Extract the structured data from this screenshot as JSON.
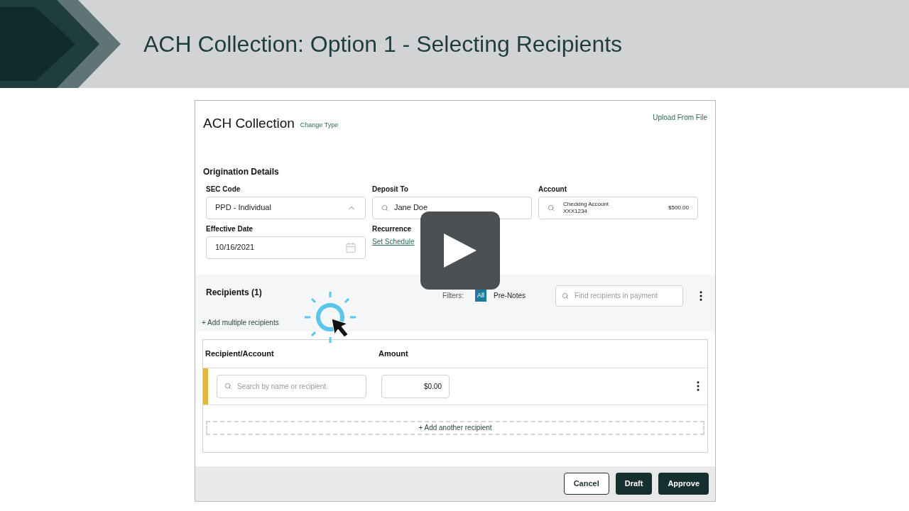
{
  "slide": {
    "title": "ACH Collection: Option 1 - Selecting Recipients"
  },
  "header": {
    "title": "ACH Collection",
    "change_link": "Change Type",
    "upload_link": "Upload From File"
  },
  "origination": {
    "heading": "Origination Details",
    "fields": [
      {
        "kind": "select",
        "label": "SEC Code",
        "value": "PPD - Individual"
      },
      {
        "kind": "search",
        "label": "Deposit To",
        "value": "Jane Doe"
      },
      {
        "kind": "account",
        "label": "Account",
        "value": "Checking Account",
        "sub": "XXX1234",
        "amount": "$500.00"
      },
      {
        "kind": "date",
        "label": "Effective Date",
        "value": "10/16/2021"
      },
      {
        "kind": "link",
        "label": "Recurrence",
        "value": "Set Schedule"
      }
    ]
  },
  "recipients": {
    "heading": "Recipients (1)",
    "add_multiple": "+ Add multiple recipients",
    "filters_label": "Filters:",
    "filters": [
      {
        "label": "All",
        "selected": true
      },
      {
        "label": "Pre-Notes",
        "selected": false
      }
    ],
    "search": {
      "placeholder": "Find recipients in payment"
    }
  },
  "table": {
    "columns": [
      "Recipient/Account",
      "Amount"
    ],
    "rows": [
      {
        "search_placeholder": "Search by name or recipient.",
        "amount": "$0.00"
      }
    ],
    "add_row": "+ Add another recipient"
  },
  "buttons": [
    {
      "label": "Cancel",
      "kind": "outline"
    },
    {
      "label": "Draft",
      "kind": "solid"
    },
    {
      "label": "Approve",
      "kind": "solid"
    }
  ]
}
